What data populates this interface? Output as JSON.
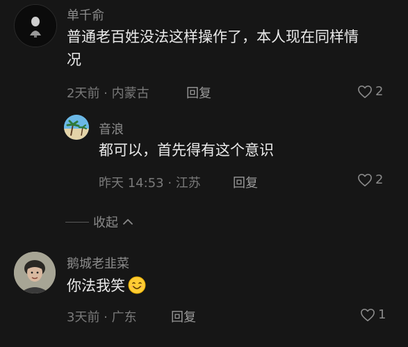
{
  "comments": [
    {
      "username": "单千俞",
      "text_line1": "普通老百姓没法这样操作了，本人现在同样情",
      "text_line2": "况",
      "time_location": "2天前 · 内蒙古",
      "reply_label": "回复",
      "likes": "2",
      "replies": [
        {
          "username": "音浪",
          "text": "都可以，首先得有这个意识",
          "time_location": "昨天 14:53 · 江苏",
          "reply_label": "回复",
          "likes": "2"
        }
      ],
      "collapse_label": "收起"
    },
    {
      "username": "鹅城老韭菜",
      "text": "你法我笑",
      "emoji": "smiling-face-emoji",
      "time_location": "3天前 · 广东",
      "reply_label": "回复",
      "likes": "1"
    }
  ],
  "colors": {
    "background": "#161616",
    "username": "#8c8c8c",
    "content": "#eaeaea",
    "meta": "#7a7a7a"
  }
}
